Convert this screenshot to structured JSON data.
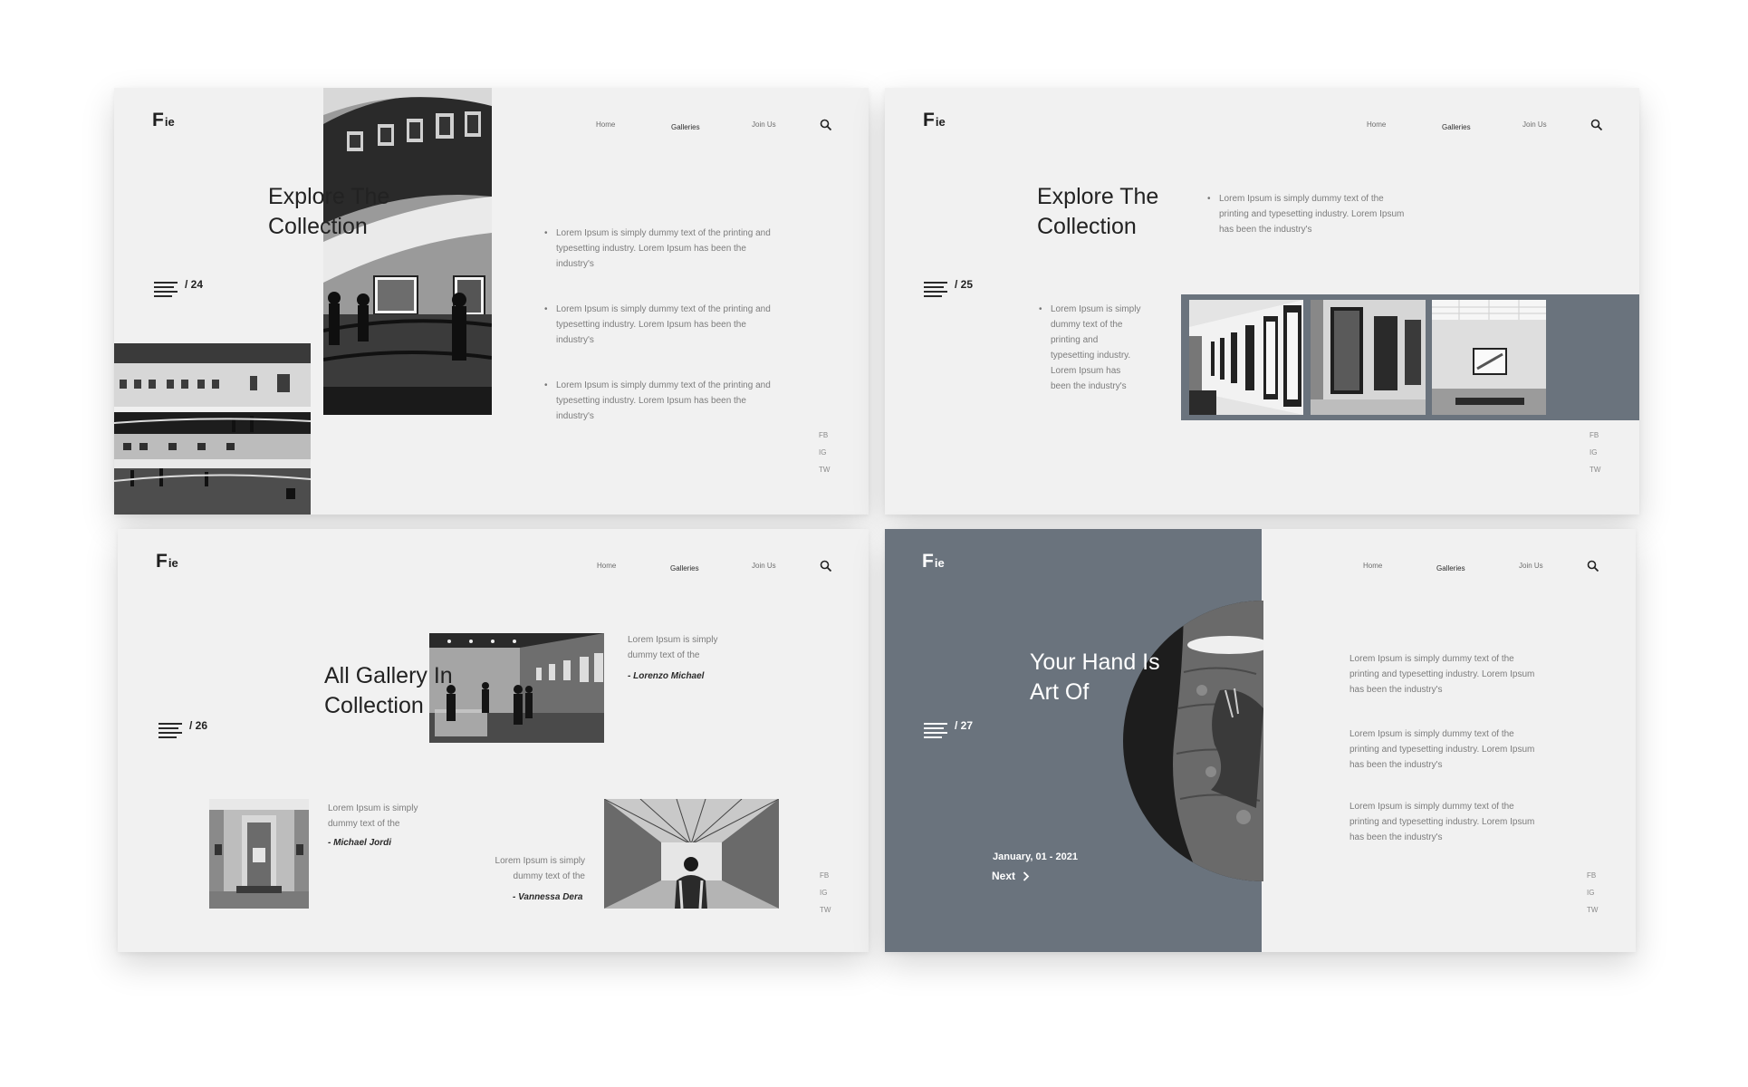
{
  "brand": {
    "logo_main": "F",
    "logo_small": "ie"
  },
  "nav": {
    "home": "Home",
    "galleries": "Galleries",
    "join": "Join Us"
  },
  "social": {
    "fb": "FB",
    "ig": "IG",
    "tw": "TW"
  },
  "icons": {
    "search": "search-icon",
    "menu": "menu-lines-icon",
    "next": "chevron-right-icon"
  },
  "colors": {
    "slide_bg": "#f1f1f1",
    "accent": "#6a737d",
    "text_dark": "#222222",
    "text_muted": "#7c7c7c"
  },
  "slide1": {
    "title_line1": "Explore The",
    "title_line2": "Collection",
    "page": "/ 24",
    "bullets": [
      "Lorem Ipsum is simply dummy text of the printing and typesetting industry. Lorem Ipsum has been the industry's",
      "Lorem Ipsum is simply dummy text of the printing and typesetting industry. Lorem Ipsum has been the industry's",
      "Lorem Ipsum is simply dummy text of the printing and typesetting industry. Lorem Ipsum has been the industry's"
    ]
  },
  "slide2": {
    "title_line1": "Explore The",
    "title_line2": "Collection",
    "page": "/ 25",
    "bullet_top": "Lorem Ipsum is simply dummy text of the printing and typesetting industry. Lorem Ipsum has been the industry's",
    "bullet_left": "Lorem Ipsum is simply dummy text of the printing and typesetting industry. Lorem Ipsum has been the industry's"
  },
  "slide3": {
    "title_line1": "All Gallery In",
    "title_line2": "Collection",
    "page": "/ 26",
    "quotes": [
      {
        "text": "Lorem Ipsum is simply dummy text of the",
        "author": "- Lorenzo Michael"
      },
      {
        "text": "Lorem Ipsum is simply dummy text of the",
        "author": "- Michael Jordi"
      },
      {
        "text": "Lorem Ipsum is simply dummy text of the",
        "author": "- Vannessa Dera"
      }
    ]
  },
  "slide4": {
    "title_line1": "Your Hand Is",
    "title_line2": "Art Of",
    "page": "/ 27",
    "date": "January, 01 - 2021",
    "next_label": "Next",
    "paragraphs": [
      "Lorem Ipsum is simply dummy text of the printing and typesetting industry. Lorem Ipsum has been the industry's",
      "Lorem Ipsum is simply dummy text of the printing and typesetting industry. Lorem Ipsum has been the industry's",
      "Lorem Ipsum is simply dummy text of the printing and typesetting industry. Lorem Ipsum has been the industry's"
    ]
  }
}
